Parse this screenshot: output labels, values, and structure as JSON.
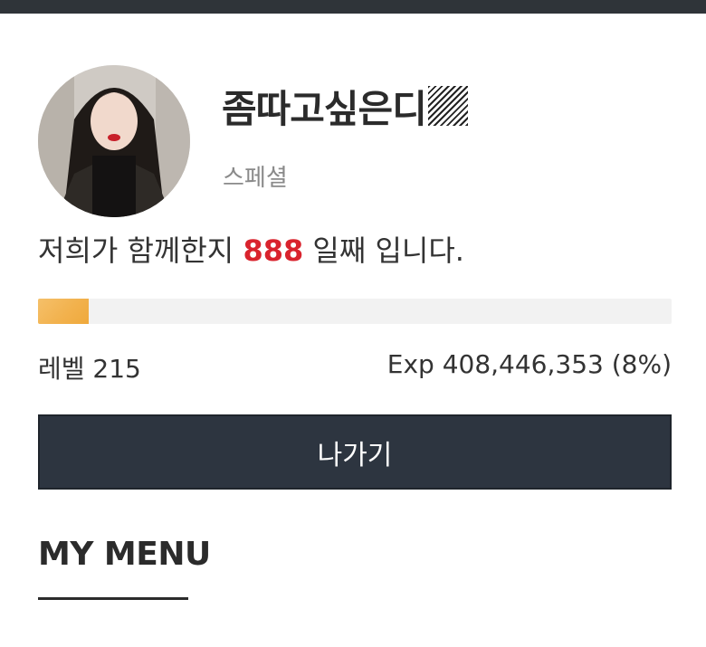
{
  "profile": {
    "username": "좀따고싶은디",
    "grade": "스페셜"
  },
  "together": {
    "prefix": "저희가 함께한지 ",
    "days": "888",
    "suffix": " 일째 입니다."
  },
  "progress": {
    "percent": 8
  },
  "level": {
    "text": "레벨 215"
  },
  "exp": {
    "text": "Exp 408,446,353 (8%)"
  },
  "exit_button": {
    "label": "나가기"
  },
  "menu": {
    "title": "MY MENU"
  },
  "colors": {
    "accent_red": "#d9232d",
    "bar_fill": "#f2b24e",
    "button_bg": "#2d3540"
  }
}
